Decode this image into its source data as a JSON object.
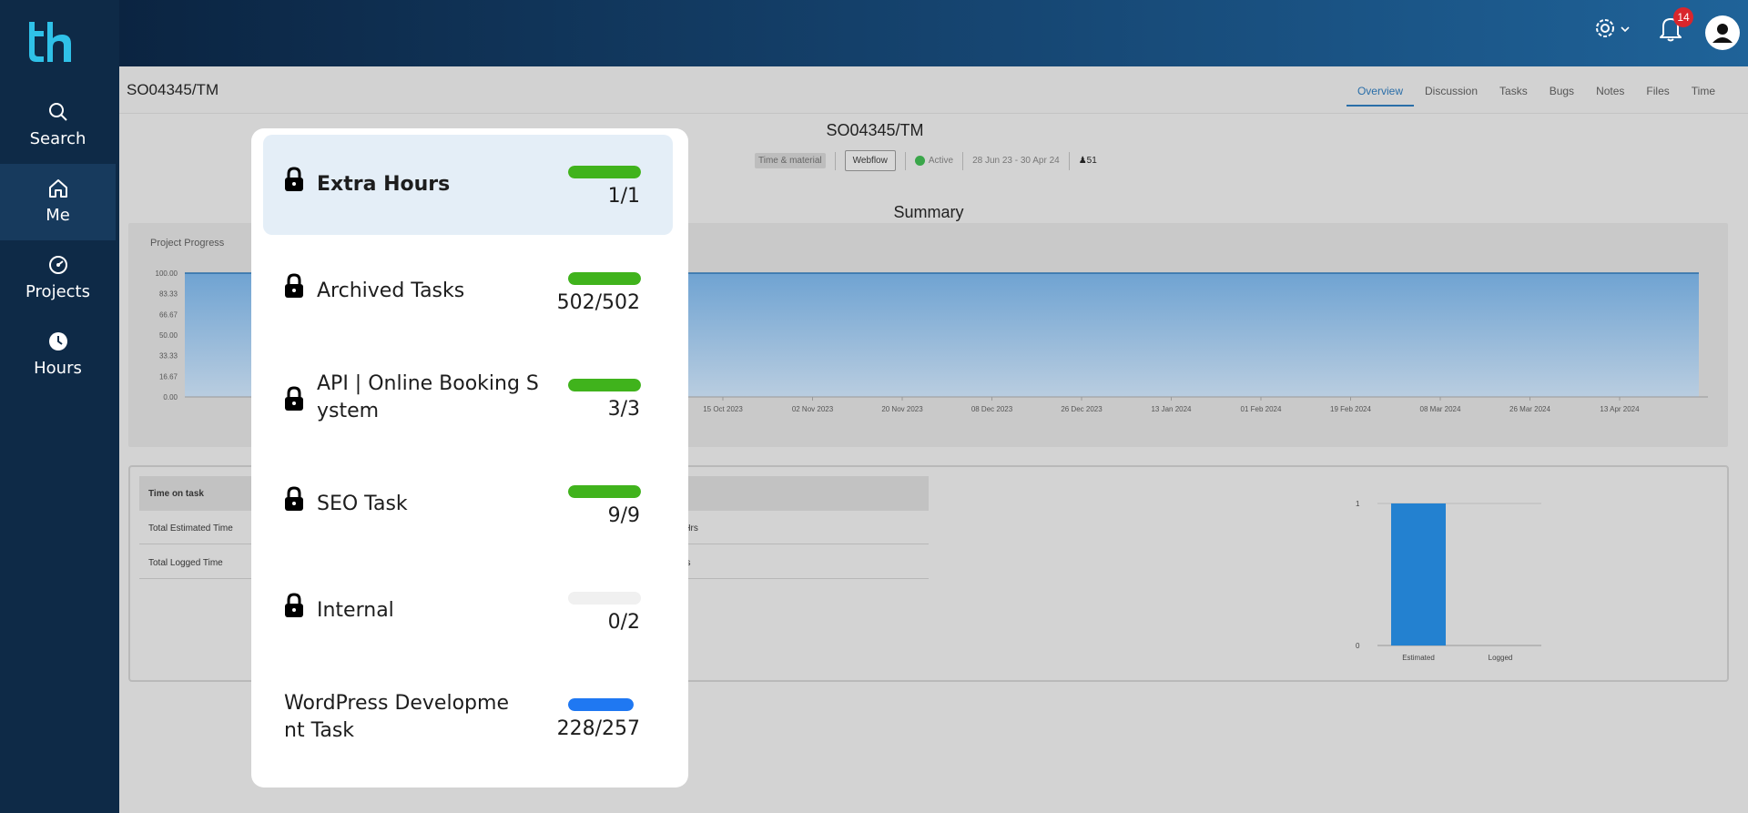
{
  "brand": {
    "logo_text": "th",
    "accent": "#2a6ea8",
    "sidebar_bg": "#0e2a47",
    "logo_color": "#2fc1e8"
  },
  "sidebar": {
    "items": [
      {
        "label": "Search",
        "icon": "search-icon"
      },
      {
        "label": "Me",
        "icon": "home-icon",
        "active": true
      },
      {
        "label": "Projects",
        "icon": "gauge-icon"
      },
      {
        "label": "Hours",
        "icon": "clock-icon"
      }
    ]
  },
  "topbar": {
    "notification_count": "14",
    "settings_icon": "gear-icon",
    "bell_icon": "bell-icon",
    "avatar_icon": "user-icon"
  },
  "page": {
    "title": "SO04345/TM",
    "tabs": [
      "Overview",
      "Discussion",
      "Tasks",
      "Bugs",
      "Notes",
      "Files",
      "Time"
    ],
    "active_tab": "Overview"
  },
  "project": {
    "title": "SO04345/TM",
    "billing": "Time & material",
    "platform": "Webflow",
    "status": "Active",
    "dates": "28 Jun 23 - 30 Apr 24",
    "members": "51",
    "summary_label": "Summary"
  },
  "progress_chart": {
    "title": "Project Progress",
    "y_ticks": [
      "100.00",
      "83.33",
      "66.67",
      "50.00",
      "33.33",
      "16.67",
      "0.00"
    ],
    "x_ticks": [
      "15 Oct 2023",
      "02 Nov 2023",
      "20 Nov 2023",
      "08 Dec 2023",
      "26 Dec 2023",
      "13 Jan 2024",
      "01 Feb 2024",
      "19 Feb 2024",
      "08 Mar 2024",
      "26 Mar 2024",
      "13 Apr 2024"
    ]
  },
  "time_table": {
    "header": "Time on task",
    "rows": [
      {
        "label": "Total Estimated Time",
        "value": "0 Hrs"
      },
      {
        "label": "Total Logged Time",
        "value": "Hrs"
      }
    ]
  },
  "chart_data": {
    "type": "bar",
    "categories": [
      "Estimated",
      "Logged"
    ],
    "values": [
      1,
      0
    ],
    "ylim": [
      0,
      1
    ],
    "y_ticks": [
      "1",
      "0"
    ],
    "colors": [
      "#2381d0"
    ]
  },
  "popup": {
    "items": [
      {
        "name": "Extra Hours",
        "count": "1/1",
        "progress": 1.0,
        "locked": true,
        "color": "#40b31c",
        "active": true
      },
      {
        "name": "Archived Tasks",
        "count": "502/502",
        "progress": 1.0,
        "locked": true,
        "color": "#40b31c"
      },
      {
        "name": "API | Online Booking S\nystem",
        "count": "3/3",
        "progress": 1.0,
        "locked": true,
        "color": "#40b31c"
      },
      {
        "name": "SEO Task",
        "count": "9/9",
        "progress": 1.0,
        "locked": true,
        "color": "#40b31c"
      },
      {
        "name": "Internal",
        "count": "0/2",
        "progress": 0.0,
        "locked": true,
        "color": "#40b31c"
      },
      {
        "name": "WordPress Developme\nnt Task",
        "count": "228/257",
        "progress": 0.887,
        "locked": false,
        "color": "#1f78f2"
      }
    ]
  }
}
